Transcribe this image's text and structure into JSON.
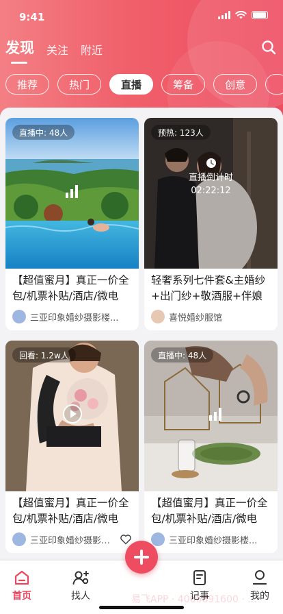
{
  "status_bar": {
    "time": "9:41"
  },
  "header": {
    "tabs": [
      {
        "label": "发现",
        "active": true
      },
      {
        "label": "关注",
        "active": false
      },
      {
        "label": "附近",
        "active": false
      }
    ],
    "categories": [
      {
        "label": "推荐",
        "active": false
      },
      {
        "label": "热门",
        "active": false
      },
      {
        "label": "直播",
        "active": true
      },
      {
        "label": "筹备",
        "active": false
      },
      {
        "label": "创意",
        "active": false
      }
    ]
  },
  "cards": [
    {
      "badge": "直播中: 48人",
      "title": "【超值蜜月】真正一价全包/机票补贴/酒店/微电",
      "author": "三亚印象婚纱摄影楼...",
      "icon": "live-signal-icon"
    },
    {
      "badge": "预热: 123人",
      "countdown_label": "直播倒计时",
      "countdown_time": "02:22:12",
      "title": "轻奢系列七件套&主婚纱+出门纱+敬酒服+伴娘服",
      "author": "喜悦婚纱服馆",
      "icon": "clock-icon"
    },
    {
      "badge": "回看: 1.2w人",
      "title": "【超值蜜月】真正一价全包/机票补贴/酒店/微电",
      "author": "三亚印象婚纱摄影楼...",
      "icon": "play-icon"
    },
    {
      "badge": "直播中: 48人",
      "title": "【超值蜜月】真正一价全包/机票补贴/酒店/微电",
      "author": "三亚印象婚纱摄影楼...",
      "icon": "live-signal-icon"
    }
  ],
  "tabbar": {
    "items": [
      {
        "label": "首页",
        "icon": "home-icon",
        "active": true
      },
      {
        "label": "找人",
        "icon": "find-people-icon",
        "active": false
      },
      {
        "label": "记事",
        "icon": "notes-icon",
        "active": false
      },
      {
        "label": "我的",
        "icon": "profile-icon",
        "active": false
      }
    ],
    "watermark": "易飞APP · 4006891600 · ..."
  },
  "colors": {
    "accent": "#ee4d61",
    "header_start": "#f37f84",
    "header_end": "#ee4d61"
  }
}
